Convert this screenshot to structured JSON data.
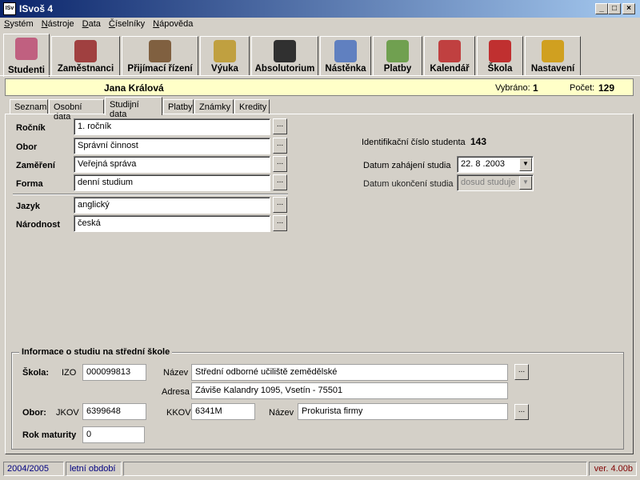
{
  "window": {
    "title": "ISvoš 4",
    "icon_text": "ISv"
  },
  "menu": [
    {
      "label": "Systém",
      "ul": "S",
      "rest": "ystém"
    },
    {
      "label": "Nástroje",
      "ul": "N",
      "rest": "ástroje"
    },
    {
      "label": "Data",
      "ul": "D",
      "rest": "ata"
    },
    {
      "label": "Číselníky",
      "ul": "Č",
      "rest": "íselníky"
    },
    {
      "label": "Nápověda",
      "ul": "N",
      "rest": "ápověda"
    }
  ],
  "modules": [
    {
      "label": "Studenti",
      "icon": "students-icon",
      "color": "#c06080"
    },
    {
      "label": "Zaměstnanci",
      "icon": "employees-icon",
      "color": "#a04040"
    },
    {
      "label": "Přijímací řízení",
      "icon": "admission-icon",
      "color": "#806040"
    },
    {
      "label": "Výuka",
      "icon": "teaching-icon",
      "color": "#c0a040"
    },
    {
      "label": "Absolutorium",
      "icon": "graduation-icon",
      "color": "#303030"
    },
    {
      "label": "Nástěnka",
      "icon": "noticeboard-icon",
      "color": "#6080c0"
    },
    {
      "label": "Platby",
      "icon": "payments-icon",
      "color": "#70a050"
    },
    {
      "label": "Kalendář",
      "icon": "calendar-icon",
      "color": "#c04040"
    },
    {
      "label": "Škola",
      "icon": "school-icon",
      "color": "#c03030"
    },
    {
      "label": "Nastavení",
      "icon": "settings-icon",
      "color": "#d0a020"
    }
  ],
  "student": {
    "name": "Jana Králová",
    "selected_label": "Vybráno:",
    "selected_value": "1",
    "count_label": "Počet:",
    "count_value": "129"
  },
  "tabs": [
    "Seznam",
    "Osobní data",
    "Studijní data",
    "Platby",
    "Známky",
    "Kredity"
  ],
  "active_tab": "Studijní data",
  "fields": {
    "rocnik": {
      "label": "Ročník",
      "value": "1. ročník"
    },
    "obor": {
      "label": "Obor",
      "value": "Správní činnost"
    },
    "zamereni": {
      "label": "Zaměření",
      "value": "Veřejná správa"
    },
    "forma": {
      "label": "Forma",
      "value": "denní studium"
    },
    "jazyk": {
      "label": "Jazyk",
      "value": "anglický"
    },
    "narodnost": {
      "label": "Národnost",
      "value": "česká"
    }
  },
  "right": {
    "id_label": "Identifikační číslo studenta",
    "id_value": "143",
    "start_label": "Datum zahájení studia",
    "start_value": "22. 8 .2003",
    "end_label": "Datum ukončení studia",
    "end_value": "dosud studuje"
  },
  "highschool": {
    "title": "Informace o studiu na střední škole",
    "skola_label": "Škola:",
    "izo_label": "IZO",
    "izo_value": "000099813",
    "nazev_label": "Název",
    "nazev_value": "Střední odborné učiliště zemědělské",
    "adresa_label": "Adresa",
    "adresa_value": "Záviše Kalandry 1095, Vsetín - 75501",
    "obor_label": "Obor:",
    "jkov_label": "JKOV",
    "jkov_value": "6399648",
    "kkov_label": "KKOV",
    "kkov_value": "6341M",
    "obor_nazev_label": "Název",
    "obor_nazev_value": "Prokurista firmy",
    "maturita_label": "Rok maturity",
    "maturita_value": "0"
  },
  "status": {
    "year": "2004/2005",
    "term": "letní období",
    "version": "ver. 4.00b",
    "accent": "#000080",
    "version_color": "#800000"
  }
}
